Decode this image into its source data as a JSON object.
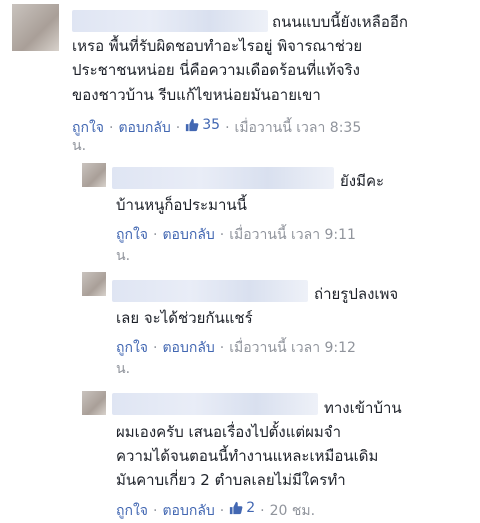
{
  "comments": [
    {
      "lines": [
        "ถนนแบบนี้ยังเหลืออีก",
        "เหรอ พื้นที่รับผิดชอบทำอะไรอยู่ พิจารณาช่วย",
        "ประชาชนหน่อย นี่คือความเดือดร้อนที่แท้จริง",
        "ของชาวบ้าน รีบแก้ไขหน่อยมันอายเขา"
      ],
      "like_label": "ถูกใจ",
      "reply_label": "ตอบกลับ",
      "likes": "35",
      "time_line1": "เมื่อวานนี้ เวลา 8:35",
      "time_line2": "น."
    },
    {
      "lines": [
        "ยังมีคะ",
        "บ้านหนูก็อประมานนี้"
      ],
      "like_label": "ถูกใจ",
      "reply_label": "ตอบกลับ",
      "time_line1": "เมื่อวานนี้ เวลา 9:11",
      "time_line2": "น."
    },
    {
      "lines": [
        "ถ่ายรูปลงเพจ",
        "เลย จะได้ช่วยกันแชร์"
      ],
      "like_label": "ถูกใจ",
      "reply_label": "ตอบกลับ",
      "time_line1": "เมื่อวานนี้ เวลา 9:12",
      "time_line2": "น."
    },
    {
      "lines": [
        "ทางเข้าบ้าน",
        "ผมเองครับ เสนอเรื่องไปตั้งแต่ผมจำ",
        "ความได้จนตอนนี้ทำงานแหละเหมือนเดิม",
        "มันคาบเกี่ยว 2 ตำบลเลยไม่มีใครทำ"
      ],
      "like_label": "ถูกใจ",
      "reply_label": "ตอบกลับ",
      "likes": "2",
      "time_line1": "20 ชม."
    }
  ],
  "separator": "·",
  "colors": {
    "link": "#4267b2",
    "meta": "#90949c",
    "text": "#1d2129"
  },
  "icons": {
    "like": "thumbs-up-icon"
  }
}
